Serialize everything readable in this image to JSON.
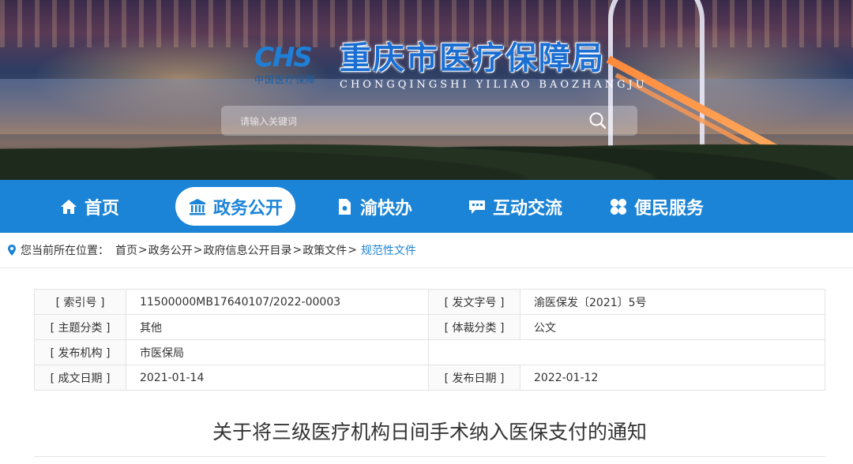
{
  "header": {
    "logo_mark": "CHS",
    "logo_sub": "中国医疗保障",
    "title": "重庆市医疗保障局",
    "pinyin": "CHONGQINGSHI YILIAO BAOZHANGJU",
    "search_placeholder": "请输入关键词"
  },
  "nav": {
    "items": [
      {
        "label": "首页",
        "icon": "home-icon"
      },
      {
        "label": "政务公开",
        "icon": "government-building-icon",
        "active": true
      },
      {
        "label": "渝快办",
        "icon": "document-icon"
      },
      {
        "label": "互动交流",
        "icon": "chat-bubble-icon"
      },
      {
        "label": "便民服务",
        "icon": "grid-flower-icon"
      }
    ]
  },
  "breadcrumb": {
    "prefix": "您当前所在位置：",
    "items": [
      "首页",
      "政务公开",
      "政府信息公开目录",
      "政策文件"
    ],
    "current": "规范性文件",
    "sep": ">"
  },
  "info": {
    "index_label": "[ 索引号 ]",
    "index_value": "11500000MB17640107/2022-00003",
    "docno_label": "[ 发文字号 ]",
    "docno_value": "渝医保发〔2021〕5号",
    "topic_label": "[ 主题分类 ]",
    "topic_value": "其他",
    "genre_label": "[ 体裁分类 ]",
    "genre_value": "公文",
    "issuer_label": "[ 发布机构 ]",
    "issuer_value": "市医保局",
    "created_label": "[ 成文日期 ]",
    "created_value": "2021-01-14",
    "published_label": "[ 发布日期 ]",
    "published_value": "2022-01-12"
  },
  "document": {
    "title": "关于将三级医疗机构日间手术纳入医保支付的通知"
  },
  "colors": {
    "primary": "#1c84d6",
    "title_blue": "#1b6fd2"
  }
}
